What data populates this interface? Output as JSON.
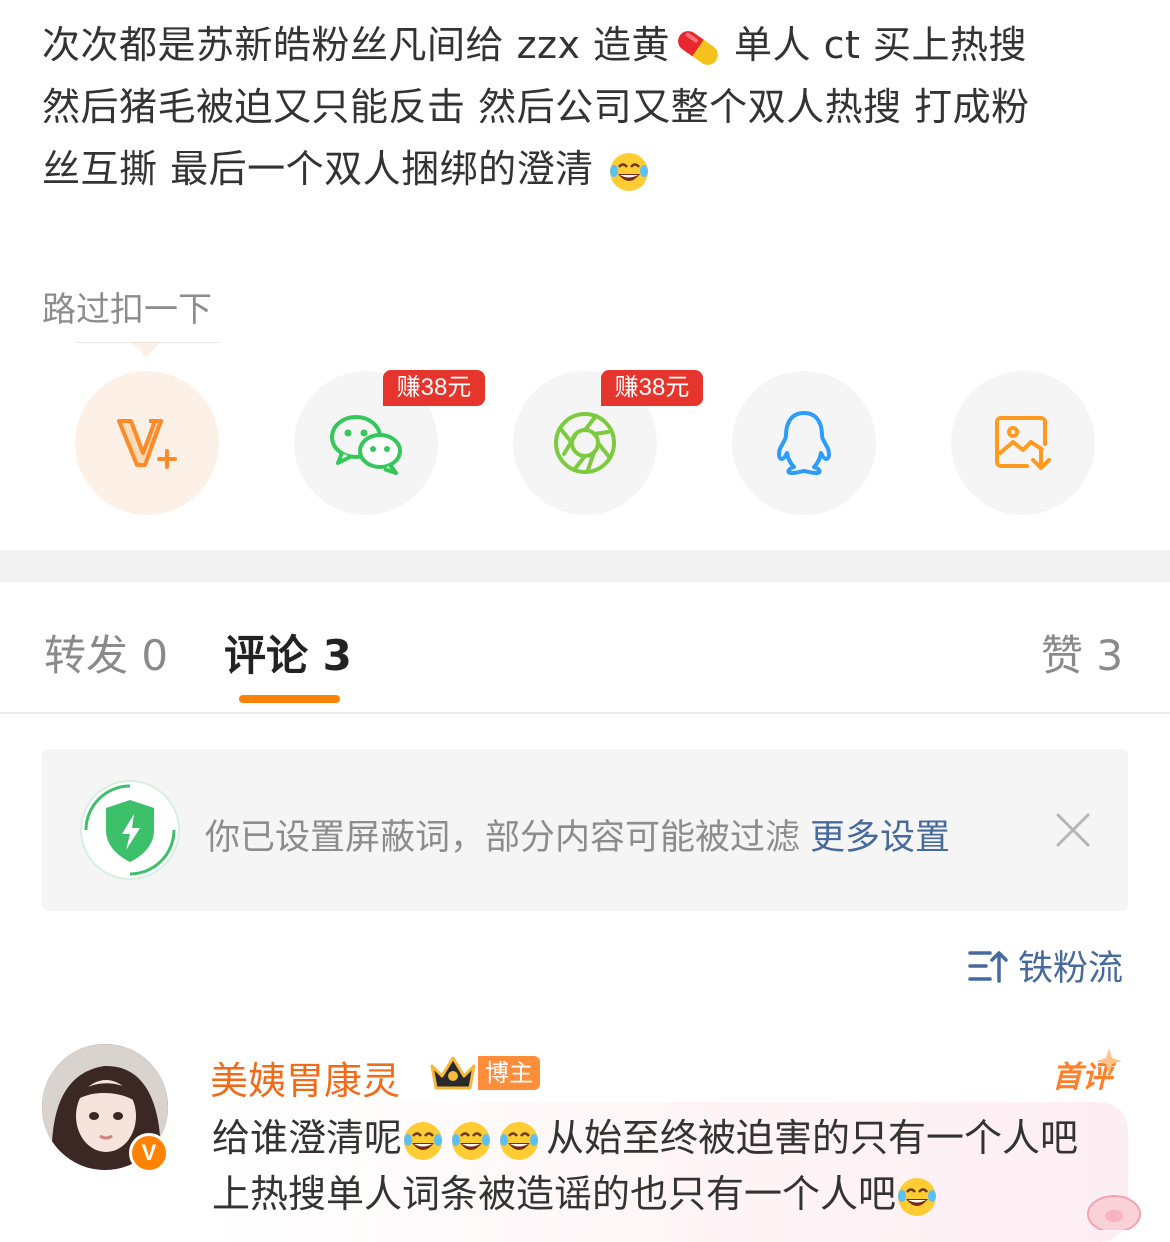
{
  "post": {
    "line1_a": "次次都是苏新皓粉丝凡间给 zzx 造黄",
    "line1_b": "单人 ct 买上热搜",
    "line2": "然后猪毛被迫又只能反击 然后公司又整个双人热搜 打成粉",
    "line3": "丝互撕 最后一个双人捆绑的澄清",
    "inline_icons": [
      "pill-emoji",
      "laughing-tears-emoji"
    ]
  },
  "tag": {
    "label": "路过扣一下"
  },
  "share": {
    "items": [
      {
        "name": "super-fan-v-plus",
        "icon": "v-plus-icon"
      },
      {
        "name": "wechat",
        "icon": "wechat-icon",
        "badge": "赚38元"
      },
      {
        "name": "moments",
        "icon": "moments-aperture-icon",
        "badge": "赚38元"
      },
      {
        "name": "qq",
        "icon": "qq-penguin-icon"
      },
      {
        "name": "save-image",
        "icon": "save-image-icon"
      }
    ]
  },
  "tabs": {
    "repost": "转发 0",
    "comments": "评论 3",
    "likes": "赞 3"
  },
  "filter_banner": {
    "text": "你已设置屏蔽词，部分内容可能被过滤",
    "link": "更多设置",
    "icon": "shield-lightning-icon"
  },
  "sort": {
    "label": "铁粉流",
    "icon": "sort-lines-icon"
  },
  "comment": {
    "user": "美姨胃康灵",
    "badge": "博主",
    "verified_mark": "V",
    "first_tag": "首评",
    "text_a": "给谁澄清呢",
    "text_b": "从始至终被迫害的只有一个人吧",
    "text_c": "上热搜单人词条被造谣的也只有一个人吧"
  },
  "colors": {
    "accent": "#ff8200",
    "link": "#466a9e",
    "username": "#f06b1a",
    "badge_red": "#e5352d",
    "wechat_green": "#34c759",
    "qq_blue": "#2d9cff"
  }
}
